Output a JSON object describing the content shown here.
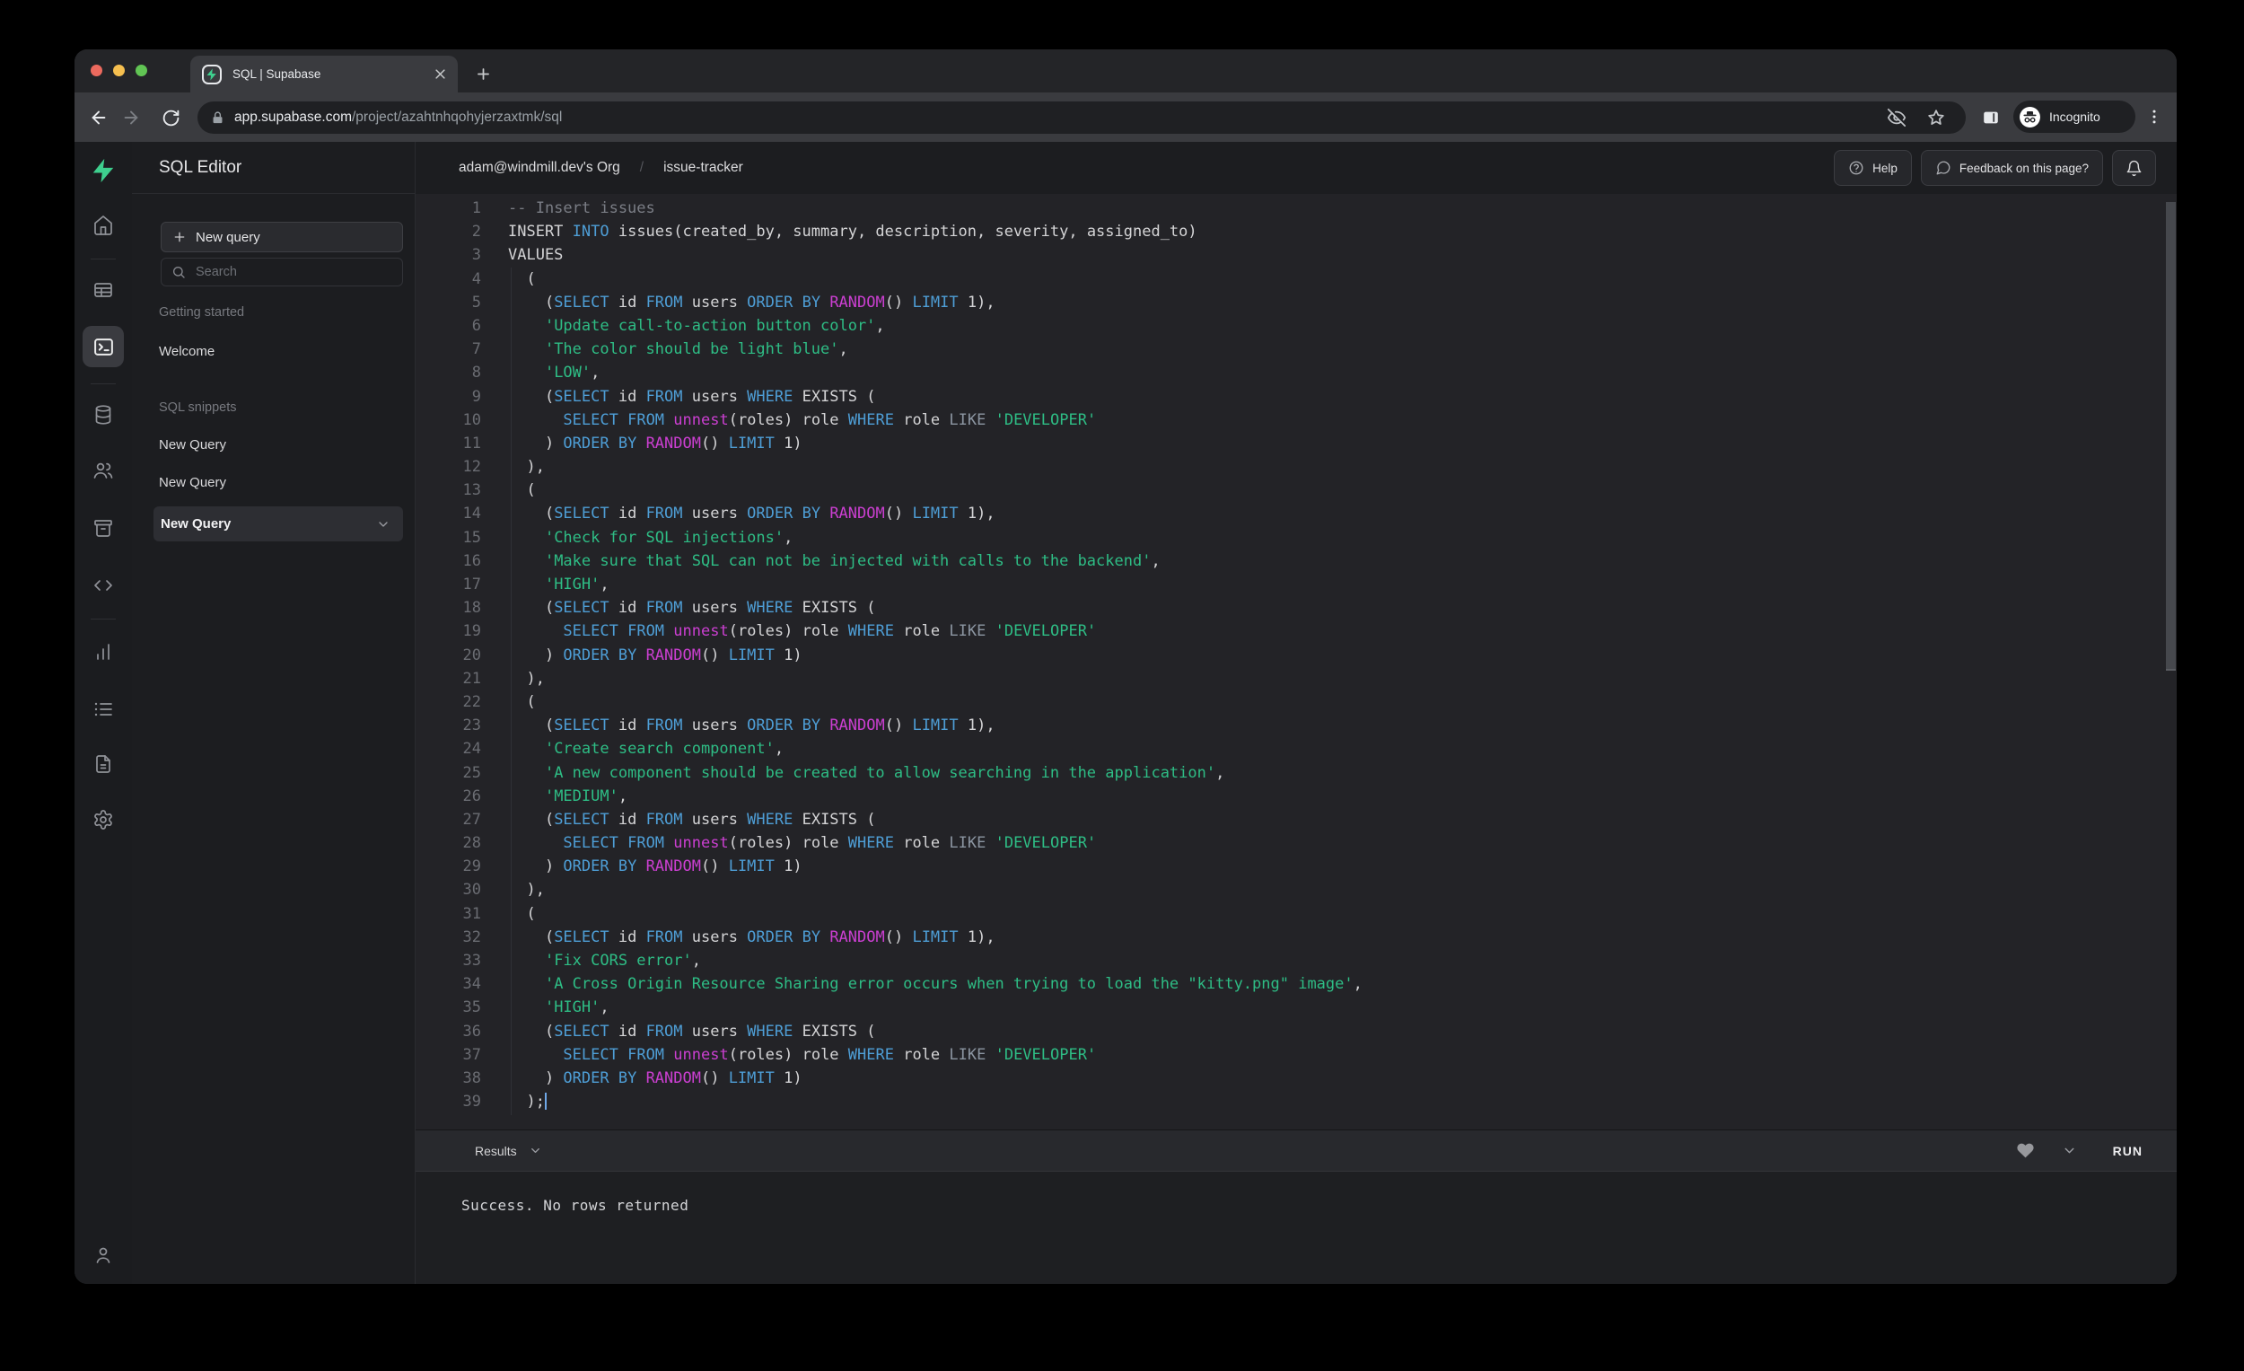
{
  "colors": {
    "accent": "#3ECF8E",
    "keyword": "#4E9ED6",
    "function": "#CB3FD1",
    "string": "#2EBD85",
    "comment": "#7A7D85",
    "operator_like": "#8B95A1",
    "plain": "#D4D4D6",
    "line_number": "#6A6C72",
    "cursor": "#6FA8E8",
    "traffic_red": "#EC6A5E",
    "traffic_yellow": "#F5BF4F",
    "traffic_green": "#61C554"
  },
  "browser": {
    "tab_title": "SQL | Supabase",
    "url_host": "app.supabase.com",
    "url_path": "/project/azahtnhqohyjerzaxtmk/sql",
    "incognito_label": "Incognito"
  },
  "sidebar": {
    "title": "SQL Editor",
    "new_query_button": "New query",
    "search_placeholder": "Search",
    "sections": [
      {
        "label": "Getting started",
        "items": [
          {
            "label": "Welcome"
          }
        ]
      },
      {
        "label": "SQL snippets",
        "items": [
          {
            "label": "New Query"
          },
          {
            "label": "New Query"
          },
          {
            "label": "New Query",
            "selected": true
          }
        ]
      }
    ]
  },
  "header": {
    "breadcrumb_org": "adam@windmill.dev's Org",
    "breadcrumb_sep": "/",
    "breadcrumb_project": "issue-tracker",
    "help_button": "Help",
    "feedback_button": "Feedback on this page?"
  },
  "results": {
    "label": "Results",
    "run_button": "RUN",
    "message": "Success. No rows returned"
  },
  "editor": {
    "lines": [
      {
        "n": 1,
        "t": [
          [
            "-- Insert issues",
            "c"
          ]
        ]
      },
      {
        "n": 2,
        "t": [
          [
            "INSERT ",
            "p"
          ],
          [
            "INTO",
            "k"
          ],
          [
            " issues(created_by, summary, description, severity, assigned_to)",
            "p"
          ]
        ]
      },
      {
        "n": 3,
        "t": [
          [
            "VALUES",
            "p"
          ]
        ]
      },
      {
        "n": 4,
        "t": [
          [
            "  (",
            "p"
          ]
        ]
      },
      {
        "n": 5,
        "t": [
          [
            "    (",
            "p"
          ],
          [
            "SELECT",
            "k"
          ],
          [
            " id ",
            "p"
          ],
          [
            "FROM",
            "k"
          ],
          [
            " users ",
            "p"
          ],
          [
            "ORDER BY",
            "k"
          ],
          [
            " ",
            "p"
          ],
          [
            "RANDOM",
            "f"
          ],
          [
            "() ",
            "p"
          ],
          [
            "LIMIT",
            "k"
          ],
          [
            " 1),",
            "p"
          ]
        ]
      },
      {
        "n": 6,
        "t": [
          [
            "    ",
            "p"
          ],
          [
            "'Update call-to-action button color'",
            "s"
          ],
          [
            ",",
            "p"
          ]
        ]
      },
      {
        "n": 7,
        "t": [
          [
            "    ",
            "p"
          ],
          [
            "'The color should be light blue'",
            "s"
          ],
          [
            ",",
            "p"
          ]
        ]
      },
      {
        "n": 8,
        "t": [
          [
            "    ",
            "p"
          ],
          [
            "'LOW'",
            "s"
          ],
          [
            ",",
            "p"
          ]
        ]
      },
      {
        "n": 9,
        "t": [
          [
            "    (",
            "p"
          ],
          [
            "SELECT",
            "k"
          ],
          [
            " id ",
            "p"
          ],
          [
            "FROM",
            "k"
          ],
          [
            " users ",
            "p"
          ],
          [
            "WHERE",
            "k"
          ],
          [
            " EXISTS (",
            "p"
          ]
        ]
      },
      {
        "n": 10,
        "t": [
          [
            "      ",
            "p"
          ],
          [
            "SELECT",
            "k"
          ],
          [
            " ",
            "p"
          ],
          [
            "FROM",
            "k"
          ],
          [
            " ",
            "p"
          ],
          [
            "unnest",
            "f"
          ],
          [
            "(roles) role ",
            "p"
          ],
          [
            "WHERE",
            "k"
          ],
          [
            " role ",
            "p"
          ],
          [
            "LIKE",
            "l"
          ],
          [
            " ",
            "p"
          ],
          [
            "'DEVELOPER'",
            "s"
          ]
        ]
      },
      {
        "n": 11,
        "t": [
          [
            "    ) ",
            "p"
          ],
          [
            "ORDER BY",
            "k"
          ],
          [
            " ",
            "p"
          ],
          [
            "RANDOM",
            "f"
          ],
          [
            "() ",
            "p"
          ],
          [
            "LIMIT",
            "k"
          ],
          [
            " 1)",
            "p"
          ]
        ]
      },
      {
        "n": 12,
        "t": [
          [
            "  ),",
            "p"
          ]
        ]
      },
      {
        "n": 13,
        "t": [
          [
            "  (",
            "p"
          ]
        ]
      },
      {
        "n": 14,
        "t": [
          [
            "    (",
            "p"
          ],
          [
            "SELECT",
            "k"
          ],
          [
            " id ",
            "p"
          ],
          [
            "FROM",
            "k"
          ],
          [
            " users ",
            "p"
          ],
          [
            "ORDER BY",
            "k"
          ],
          [
            " ",
            "p"
          ],
          [
            "RANDOM",
            "f"
          ],
          [
            "() ",
            "p"
          ],
          [
            "LIMIT",
            "k"
          ],
          [
            " 1),",
            "p"
          ]
        ]
      },
      {
        "n": 15,
        "t": [
          [
            "    ",
            "p"
          ],
          [
            "'Check for SQL injections'",
            "s"
          ],
          [
            ",",
            "p"
          ]
        ]
      },
      {
        "n": 16,
        "t": [
          [
            "    ",
            "p"
          ],
          [
            "'Make sure that SQL can not be injected with calls to the backend'",
            "s"
          ],
          [
            ",",
            "p"
          ]
        ]
      },
      {
        "n": 17,
        "t": [
          [
            "    ",
            "p"
          ],
          [
            "'HIGH'",
            "s"
          ],
          [
            ",",
            "p"
          ]
        ]
      },
      {
        "n": 18,
        "t": [
          [
            "    (",
            "p"
          ],
          [
            "SELECT",
            "k"
          ],
          [
            " id ",
            "p"
          ],
          [
            "FROM",
            "k"
          ],
          [
            " users ",
            "p"
          ],
          [
            "WHERE",
            "k"
          ],
          [
            " EXISTS (",
            "p"
          ]
        ]
      },
      {
        "n": 19,
        "t": [
          [
            "      ",
            "p"
          ],
          [
            "SELECT",
            "k"
          ],
          [
            " ",
            "p"
          ],
          [
            "FROM",
            "k"
          ],
          [
            " ",
            "p"
          ],
          [
            "unnest",
            "f"
          ],
          [
            "(roles) role ",
            "p"
          ],
          [
            "WHERE",
            "k"
          ],
          [
            " role ",
            "p"
          ],
          [
            "LIKE",
            "l"
          ],
          [
            " ",
            "p"
          ],
          [
            "'DEVELOPER'",
            "s"
          ]
        ]
      },
      {
        "n": 20,
        "t": [
          [
            "    ) ",
            "p"
          ],
          [
            "ORDER BY",
            "k"
          ],
          [
            " ",
            "p"
          ],
          [
            "RANDOM",
            "f"
          ],
          [
            "() ",
            "p"
          ],
          [
            "LIMIT",
            "k"
          ],
          [
            " 1)",
            "p"
          ]
        ]
      },
      {
        "n": 21,
        "t": [
          [
            "  ),",
            "p"
          ]
        ]
      },
      {
        "n": 22,
        "t": [
          [
            "  (",
            "p"
          ]
        ]
      },
      {
        "n": 23,
        "t": [
          [
            "    (",
            "p"
          ],
          [
            "SELECT",
            "k"
          ],
          [
            " id ",
            "p"
          ],
          [
            "FROM",
            "k"
          ],
          [
            " users ",
            "p"
          ],
          [
            "ORDER BY",
            "k"
          ],
          [
            " ",
            "p"
          ],
          [
            "RANDOM",
            "f"
          ],
          [
            "() ",
            "p"
          ],
          [
            "LIMIT",
            "k"
          ],
          [
            " 1),",
            "p"
          ]
        ]
      },
      {
        "n": 24,
        "t": [
          [
            "    ",
            "p"
          ],
          [
            "'Create search component'",
            "s"
          ],
          [
            ",",
            "p"
          ]
        ]
      },
      {
        "n": 25,
        "t": [
          [
            "    ",
            "p"
          ],
          [
            "'A new component should be created to allow searching in the application'",
            "s"
          ],
          [
            ",",
            "p"
          ]
        ]
      },
      {
        "n": 26,
        "t": [
          [
            "    ",
            "p"
          ],
          [
            "'MEDIUM'",
            "s"
          ],
          [
            ",",
            "p"
          ]
        ]
      },
      {
        "n": 27,
        "t": [
          [
            "    (",
            "p"
          ],
          [
            "SELECT",
            "k"
          ],
          [
            " id ",
            "p"
          ],
          [
            "FROM",
            "k"
          ],
          [
            " users ",
            "p"
          ],
          [
            "WHERE",
            "k"
          ],
          [
            " EXISTS (",
            "p"
          ]
        ]
      },
      {
        "n": 28,
        "t": [
          [
            "      ",
            "p"
          ],
          [
            "SELECT",
            "k"
          ],
          [
            " ",
            "p"
          ],
          [
            "FROM",
            "k"
          ],
          [
            " ",
            "p"
          ],
          [
            "unnest",
            "f"
          ],
          [
            "(roles) role ",
            "p"
          ],
          [
            "WHERE",
            "k"
          ],
          [
            " role ",
            "p"
          ],
          [
            "LIKE",
            "l"
          ],
          [
            " ",
            "p"
          ],
          [
            "'DEVELOPER'",
            "s"
          ]
        ]
      },
      {
        "n": 29,
        "t": [
          [
            "    ) ",
            "p"
          ],
          [
            "ORDER BY",
            "k"
          ],
          [
            " ",
            "p"
          ],
          [
            "RANDOM",
            "f"
          ],
          [
            "() ",
            "p"
          ],
          [
            "LIMIT",
            "k"
          ],
          [
            " 1)",
            "p"
          ]
        ]
      },
      {
        "n": 30,
        "t": [
          [
            "  ),",
            "p"
          ]
        ]
      },
      {
        "n": 31,
        "t": [
          [
            "  (",
            "p"
          ]
        ]
      },
      {
        "n": 32,
        "t": [
          [
            "    (",
            "p"
          ],
          [
            "SELECT",
            "k"
          ],
          [
            " id ",
            "p"
          ],
          [
            "FROM",
            "k"
          ],
          [
            " users ",
            "p"
          ],
          [
            "ORDER BY",
            "k"
          ],
          [
            " ",
            "p"
          ],
          [
            "RANDOM",
            "f"
          ],
          [
            "() ",
            "p"
          ],
          [
            "LIMIT",
            "k"
          ],
          [
            " 1),",
            "p"
          ]
        ]
      },
      {
        "n": 33,
        "t": [
          [
            "    ",
            "p"
          ],
          [
            "'Fix CORS error'",
            "s"
          ],
          [
            ",",
            "p"
          ]
        ]
      },
      {
        "n": 34,
        "t": [
          [
            "    ",
            "p"
          ],
          [
            "'A Cross Origin Resource Sharing error occurs when trying to load the \"kitty.png\" image'",
            "s"
          ],
          [
            ",",
            "p"
          ]
        ]
      },
      {
        "n": 35,
        "t": [
          [
            "    ",
            "p"
          ],
          [
            "'HIGH'",
            "s"
          ],
          [
            ",",
            "p"
          ]
        ]
      },
      {
        "n": 36,
        "t": [
          [
            "    (",
            "p"
          ],
          [
            "SELECT",
            "k"
          ],
          [
            " id ",
            "p"
          ],
          [
            "FROM",
            "k"
          ],
          [
            " users ",
            "p"
          ],
          [
            "WHERE",
            "k"
          ],
          [
            " EXISTS (",
            "p"
          ]
        ]
      },
      {
        "n": 37,
        "t": [
          [
            "      ",
            "p"
          ],
          [
            "SELECT",
            "k"
          ],
          [
            " ",
            "p"
          ],
          [
            "FROM",
            "k"
          ],
          [
            " ",
            "p"
          ],
          [
            "unnest",
            "f"
          ],
          [
            "(roles) role ",
            "p"
          ],
          [
            "WHERE",
            "k"
          ],
          [
            " role ",
            "p"
          ],
          [
            "LIKE",
            "l"
          ],
          [
            " ",
            "p"
          ],
          [
            "'DEVELOPER'",
            "s"
          ]
        ]
      },
      {
        "n": 38,
        "t": [
          [
            "    ) ",
            "p"
          ],
          [
            "ORDER BY",
            "k"
          ],
          [
            " ",
            "p"
          ],
          [
            "RANDOM",
            "f"
          ],
          [
            "() ",
            "p"
          ],
          [
            "LIMIT",
            "k"
          ],
          [
            " 1)",
            "p"
          ]
        ]
      },
      {
        "n": 39,
        "t": [
          [
            "  );",
            "p"
          ]
        ],
        "cursor": true
      }
    ]
  }
}
